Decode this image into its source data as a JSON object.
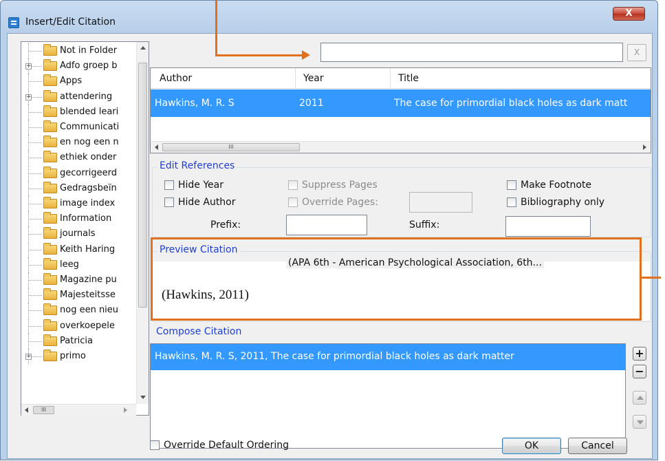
{
  "window": {
    "title": "Insert/Edit Citation",
    "close_label": "X"
  },
  "tree": {
    "items": [
      {
        "label": "Not in Folder",
        "expander": ""
      },
      {
        "label": "Adfo groep b",
        "expander": "+"
      },
      {
        "label": "Apps",
        "expander": ""
      },
      {
        "label": "attendering",
        "expander": "+"
      },
      {
        "label": "blended leari",
        "expander": ""
      },
      {
        "label": "Communicati",
        "expander": ""
      },
      {
        "label": "en nog een n",
        "expander": ""
      },
      {
        "label": "ethiek onder",
        "expander": ""
      },
      {
        "label": "gecorrigeerd",
        "expander": ""
      },
      {
        "label": "Gedragsbeïn",
        "expander": ""
      },
      {
        "label": "image index",
        "expander": ""
      },
      {
        "label": "Information",
        "expander": ""
      },
      {
        "label": "journals",
        "expander": ""
      },
      {
        "label": "Keith Haring",
        "expander": ""
      },
      {
        "label": "leeg",
        "expander": ""
      },
      {
        "label": "Magazine pu",
        "expander": ""
      },
      {
        "label": "Majesteitsse",
        "expander": ""
      },
      {
        "label": "nog een nieu",
        "expander": ""
      },
      {
        "label": "overkoepele",
        "expander": ""
      },
      {
        "label": "Patricia",
        "expander": ""
      },
      {
        "label": "primo",
        "expander": "+"
      }
    ],
    "hscroll_grip": "III"
  },
  "search": {
    "value": "",
    "clear_label": "X"
  },
  "results": {
    "columns": [
      "Author",
      "Year",
      "Title"
    ],
    "rows": [
      {
        "author": "Hawkins, M. R. S",
        "year": "2011",
        "title": "The case for primordial black holes as dark matt"
      }
    ],
    "hscroll_grip": "III"
  },
  "edit_refs": {
    "label": "Edit References",
    "hide_year": "Hide Year",
    "hide_author": "Hide Author",
    "suppress_pages": "Suppress Pages",
    "override_pages": "Override Pages:",
    "make_footnote": "Make Footnote",
    "bibliography_only": "Bibliography only",
    "prefix_label": "Prefix:",
    "suffix_label": "Suffix:",
    "prefix_value": "",
    "suffix_value": "",
    "override_value": ""
  },
  "preview": {
    "label": "Preview Citation",
    "style": "(APA 6th - American Psychological Association, 6th...",
    "text": "(Hawkins, 2011)"
  },
  "compose": {
    "label": "Compose Citation",
    "items": [
      "Hawkins, M. R. S, 2011, The case for primordial black holes as dark matter"
    ]
  },
  "footer": {
    "override_ordering": "Override Default Ordering",
    "ok": "OK",
    "cancel": "Cancel"
  },
  "colors": {
    "annotation": "#e0701c",
    "selection": "#3399ff",
    "group_label": "#1f3ed3"
  }
}
